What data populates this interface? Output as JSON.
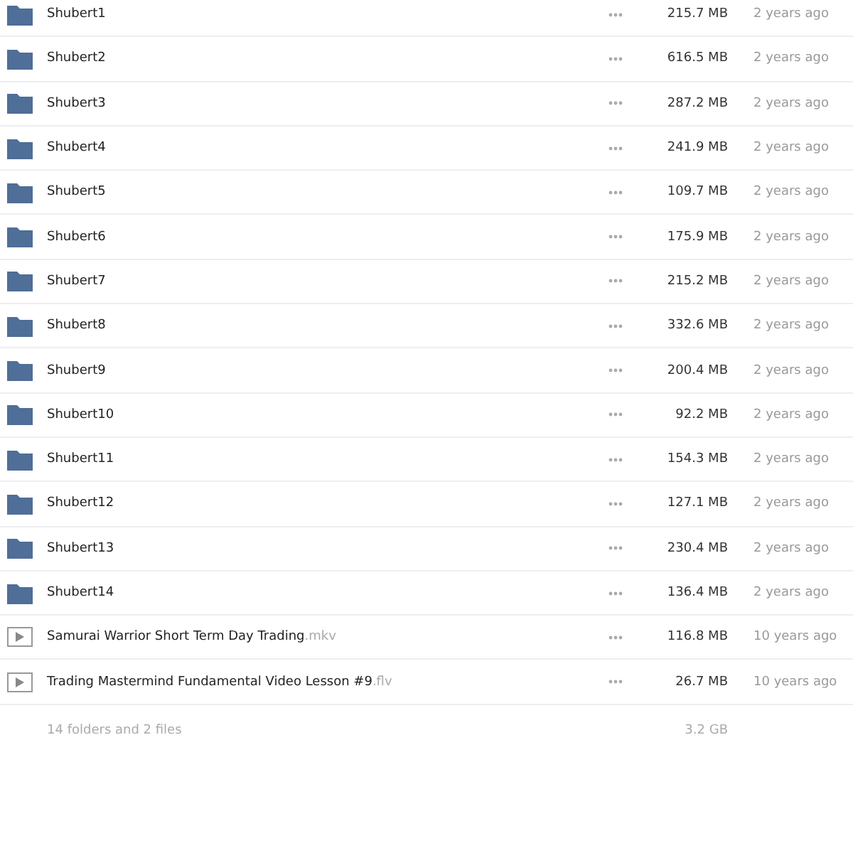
{
  "items": [
    {
      "kind": "folder",
      "name": "Shubert1",
      "size": "215.7 MB",
      "modified": "2 years ago"
    },
    {
      "kind": "folder",
      "name": "Shubert2",
      "size": "616.5 MB",
      "modified": "2 years ago"
    },
    {
      "kind": "folder",
      "name": "Shubert3",
      "size": "287.2 MB",
      "modified": "2 years ago"
    },
    {
      "kind": "folder",
      "name": "Shubert4",
      "size": "241.9 MB",
      "modified": "2 years ago"
    },
    {
      "kind": "folder",
      "name": "Shubert5",
      "size": "109.7 MB",
      "modified": "2 years ago"
    },
    {
      "kind": "folder",
      "name": "Shubert6",
      "size": "175.9 MB",
      "modified": "2 years ago"
    },
    {
      "kind": "folder",
      "name": "Shubert7",
      "size": "215.2 MB",
      "modified": "2 years ago"
    },
    {
      "kind": "folder",
      "name": "Shubert8",
      "size": "332.6 MB",
      "modified": "2 years ago"
    },
    {
      "kind": "folder",
      "name": "Shubert9",
      "size": "200.4 MB",
      "modified": "2 years ago"
    },
    {
      "kind": "folder",
      "name": "Shubert10",
      "size": "92.2 MB",
      "modified": "2 years ago"
    },
    {
      "kind": "folder",
      "name": "Shubert11",
      "size": "154.3 MB",
      "modified": "2 years ago"
    },
    {
      "kind": "folder",
      "name": "Shubert12",
      "size": "127.1 MB",
      "modified": "2 years ago"
    },
    {
      "kind": "folder",
      "name": "Shubert13",
      "size": "230.4 MB",
      "modified": "2 years ago"
    },
    {
      "kind": "folder",
      "name": "Shubert14",
      "size": "136.4 MB",
      "modified": "2 years ago"
    },
    {
      "kind": "video",
      "name": "Samurai Warrior Short Term Day Trading",
      "extension": ".mkv",
      "size": "116.8 MB",
      "modified": "10 years ago"
    },
    {
      "kind": "video",
      "name": "Trading Mastermind Fundamental Video Lesson #9",
      "extension": ".flv",
      "size": "26.7 MB",
      "modified": "10 years ago"
    }
  ],
  "footer": {
    "summary": "14 folders and 2 files",
    "total": "3.2 GB"
  }
}
